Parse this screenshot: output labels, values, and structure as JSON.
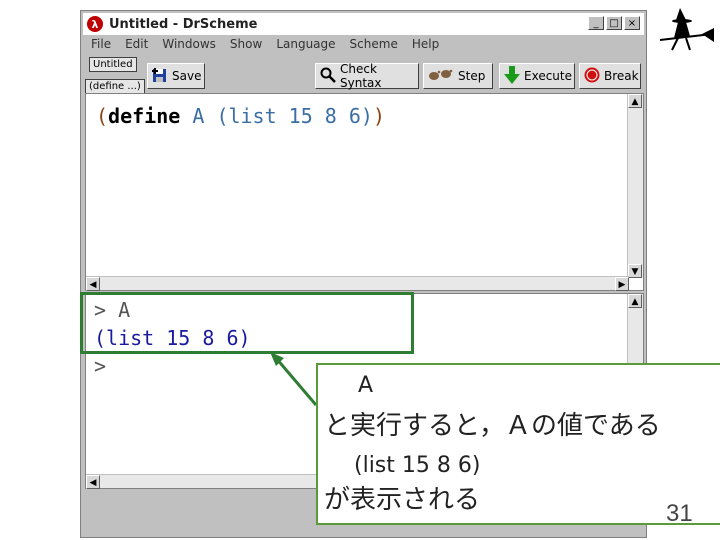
{
  "window": {
    "title": "Untitled - DrScheme",
    "icon_letter": "λ",
    "controls": [
      "_",
      "□",
      "×"
    ]
  },
  "menu": [
    {
      "label": "File"
    },
    {
      "label": "Edit"
    },
    {
      "label": "Windows"
    },
    {
      "label": "Show"
    },
    {
      "label": "Language"
    },
    {
      "label": "Scheme"
    },
    {
      "label": "Help"
    }
  ],
  "toolbar": {
    "tab_label": "Untitled",
    "define_label": "(define ...)",
    "save_label": "Save",
    "check_syntax_label": "Check Syntax",
    "step_label": "Step",
    "execute_label": "Execute",
    "break_label": "Break"
  },
  "definitions": {
    "paren_open": "(",
    "keyword": "define",
    "name": "A",
    "expr": "(list 15 8 6)",
    "paren_close": ")"
  },
  "interactions": {
    "prompt1": "> A",
    "result": "(list 15 8 6)",
    "prompt2": ">"
  },
  "callout": {
    "line1": "A",
    "line2": "と実行すると，Ａの値である",
    "line3": "(list 15 8 6)",
    "line4": "が表示される"
  },
  "slide": {
    "page_number": "31"
  },
  "colors": {
    "keyword": "#000000",
    "identifier": "#3a6ea5",
    "number": "#1a7a7a",
    "paren": "#8b4513",
    "result": "#1a1aa0",
    "highlight": "#2e7d32"
  }
}
